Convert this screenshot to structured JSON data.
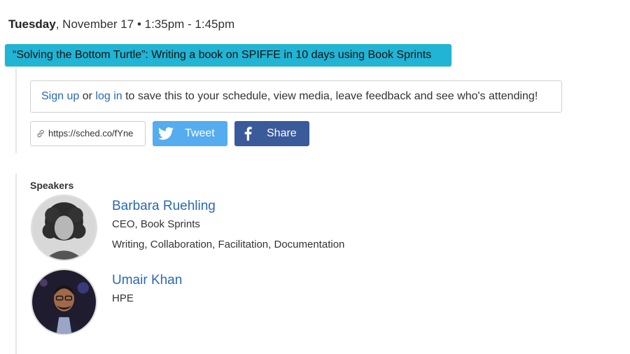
{
  "session": {
    "day": "Tuesday",
    "date_time": ", November 17 • 1:35pm - 1:45pm",
    "title": "“Solving the Bottom Turtle”: Writing a book on SPIFFE in 10 days using Book Sprints"
  },
  "signup": {
    "signup_link": "Sign up",
    "or_text": " or ",
    "login_link": "log in",
    "rest_text": " to save this to your schedule, view media, leave feedback and see who's attending!"
  },
  "share": {
    "url": "https://sched.co/fYne",
    "tweet_label": "Tweet",
    "share_label": "Share",
    "twitter_color": "#55acee",
    "facebook_color": "#3b5a9a"
  },
  "speakers": {
    "heading": "Speakers",
    "items": [
      {
        "name": "Barbara Ruehling",
        "title": "CEO, Book Sprints",
        "tags": "Writing, Collaboration, Facilitation, Documentation"
      },
      {
        "name": "Umair Khan",
        "title": "HPE"
      }
    ]
  },
  "colors": {
    "title_bar": "#21b4d4",
    "link": "#2a6ab2"
  }
}
